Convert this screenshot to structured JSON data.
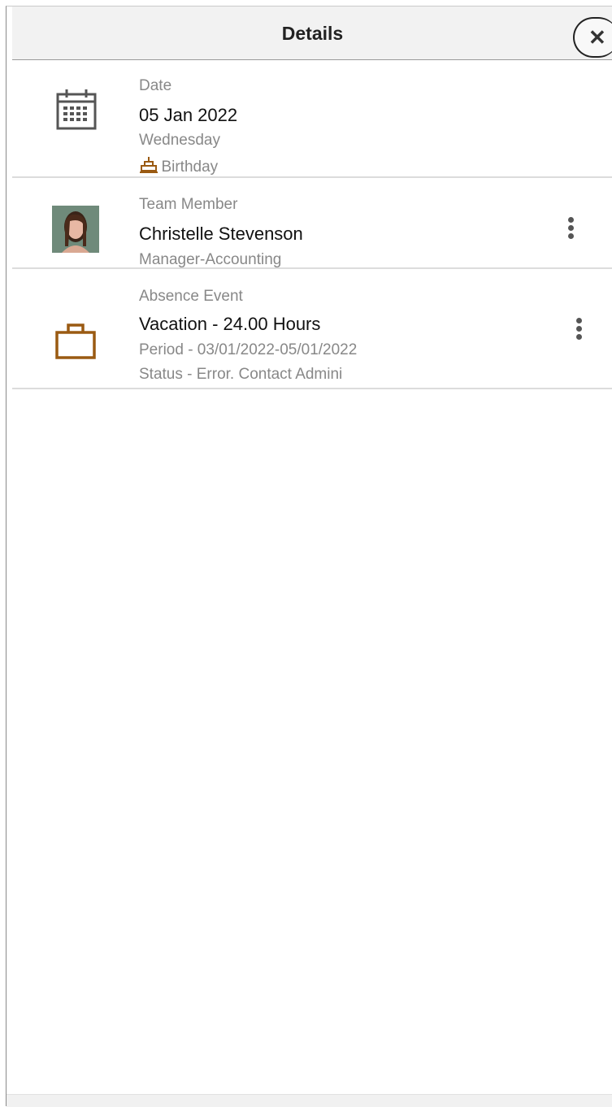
{
  "header": {
    "title": "Details",
    "close_glyph": "✕"
  },
  "date_section": {
    "label": "Date",
    "value": "05 Jan 2022",
    "weekday": "Wednesday",
    "event": "Birthday",
    "icon": "calendar-icon",
    "event_icon": "cake-icon"
  },
  "team_member": {
    "label": "Team Member",
    "name": "Christelle Stevenson",
    "role": "Manager-Accounting",
    "icon": "avatar"
  },
  "absence": {
    "label": "Absence Event",
    "title": "Vacation - 24.00 Hours",
    "period": "Period - 03/01/2022-05/01/2022",
    "status": "Status - Error. Contact Admini",
    "icon": "briefcase-icon",
    "icon_color": "#9a5a12"
  }
}
